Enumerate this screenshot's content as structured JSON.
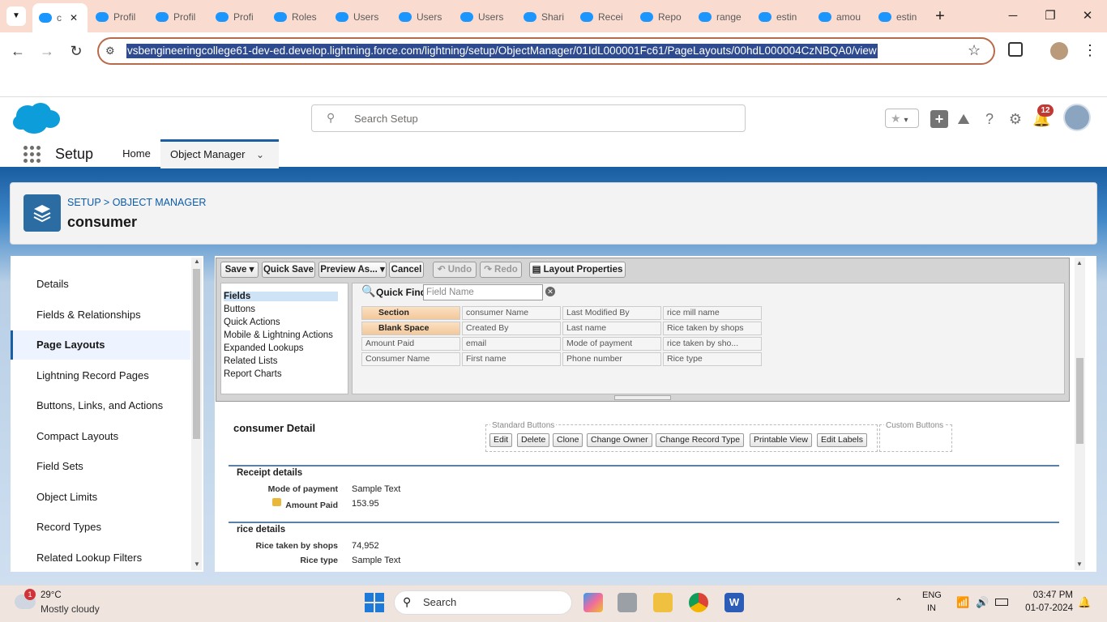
{
  "browser": {
    "tabs": [
      {
        "label": "c",
        "active": true
      },
      {
        "label": "Profil"
      },
      {
        "label": "Profil"
      },
      {
        "label": "Profi"
      },
      {
        "label": "Roles"
      },
      {
        "label": "Users"
      },
      {
        "label": "Users"
      },
      {
        "label": "Users"
      },
      {
        "label": "Shari"
      },
      {
        "label": "Recei"
      },
      {
        "label": "Repo"
      },
      {
        "label": "range"
      },
      {
        "label": "estin"
      },
      {
        "label": "amou"
      },
      {
        "label": "estin"
      }
    ],
    "url": "vsbengineeringcollege61-dev-ed.develop.lightning.force.com/lightning/setup/ObjectManager/01IdL000001Fc61/PageLayouts/00hdL000004CzNBQA0/view"
  },
  "header": {
    "search_placeholder": "Search Setup",
    "notification_count": "12"
  },
  "nav": {
    "app_name": "Setup",
    "home": "Home",
    "object_manager": "Object Manager"
  },
  "object": {
    "breadcrumb": "SETUP > OBJECT MANAGER",
    "title": "consumer"
  },
  "sidebar": {
    "items": [
      "Details",
      "Fields & Relationships",
      "Page Layouts",
      "Lightning Record Pages",
      "Buttons, Links, and Actions",
      "Compact Layouts",
      "Field Sets",
      "Object Limits",
      "Record Types",
      "Related Lookup Filters"
    ],
    "active": "Page Layouts"
  },
  "toolbar": {
    "save": "Save",
    "quick_save": "Quick Save",
    "preview_as": "Preview As...",
    "cancel": "Cancel",
    "undo": "Undo",
    "redo": "Redo",
    "layout_properties": "Layout Properties"
  },
  "palette": {
    "categories": [
      "Fields",
      "Buttons",
      "Quick Actions",
      "Mobile & Lightning Actions",
      "Expanded Lookups",
      "Related Lists",
      "Report Charts"
    ],
    "quick_find_label": "Quick Find",
    "quick_find_placeholder": "Field Name",
    "fields": [
      [
        "Section",
        "consumer Name",
        "Last Modified By",
        "rice mill name"
      ],
      [
        "Blank Space",
        "Created By",
        "Last name",
        "Rice taken by shops"
      ],
      [
        "Amount Paid",
        "email",
        "Mode of payment",
        "rice taken by sho..."
      ],
      [
        "Consumer Name",
        "First name",
        "Phone number",
        "Rice type"
      ]
    ]
  },
  "detail": {
    "title": "consumer Detail",
    "standard_buttons_label": "Standard Buttons",
    "custom_buttons_label": "Custom Buttons",
    "standard_buttons": [
      "Edit",
      "Delete",
      "Clone",
      "Change Owner",
      "Change Record Type",
      "Printable View",
      "Edit Labels"
    ],
    "sections": [
      {
        "title": "Receipt details",
        "rows": [
          {
            "label": "Mode of payment",
            "value": "Sample Text"
          },
          {
            "label": "Amount Paid",
            "value": "153.95"
          }
        ]
      },
      {
        "title": "rice details",
        "rows": [
          {
            "label": "Rice taken by shops",
            "value": "74,952"
          },
          {
            "label": "Rice type",
            "value": "Sample Text"
          }
        ]
      }
    ]
  },
  "taskbar": {
    "weather_badge": "1",
    "temperature": "29°C",
    "weather": "Mostly cloudy",
    "search": "Search",
    "lang1": "ENG",
    "lang2": "IN",
    "time": "03:47 PM",
    "date": "01-07-2024"
  }
}
